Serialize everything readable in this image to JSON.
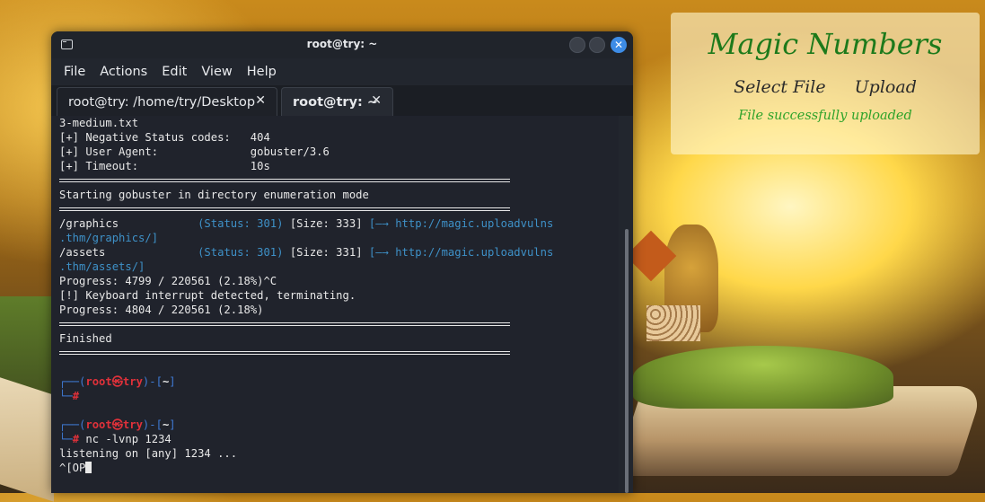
{
  "window": {
    "title": "root@try: ~",
    "close_glyph": "✕"
  },
  "menu": [
    "File",
    "Actions",
    "Edit",
    "View",
    "Help"
  ],
  "tabs": [
    {
      "label": "root@try: /home/try/Desktop",
      "close": "✕"
    },
    {
      "label": "root@try: ~",
      "close": "✕"
    }
  ],
  "terminal": {
    "lines": {
      "l1": "3-medium.txt",
      "l2": "[+] Negative Status codes:   404",
      "l3": "[+] User Agent:              gobuster/3.6",
      "l4": "[+] Timeout:                 10s",
      "l5": "Starting gobuster in directory enumeration mode",
      "r1_path": "/graphics            ",
      "r1_status": "(Status: 301)",
      "r1_size": " [Size: 333] ",
      "r1_link": "[—→ http://magic.uploadvulns",
      "r1_cont": ".thm/graphics/]",
      "r2_path": "/assets              ",
      "r2_status": "(Status: 301)",
      "r2_size": " [Size: 331] ",
      "r2_link": "[—→ http://magic.uploadvulns",
      "r2_cont": ".thm/assets/]",
      "p1": "Progress: 4799 / 220561 (2.18%)^C",
      "p2": "[!] Keyboard interrupt detected, terminating.",
      "p3": "Progress: 4804 / 220561 (2.18%)",
      "finished": "Finished"
    },
    "prompt": {
      "top_open": "┌──(",
      "user": "root㉿try",
      "top_mid": ")-[",
      "dir": "~",
      "top_close": "]",
      "bottom": "└─",
      "hash": "#"
    },
    "cmd": " nc -lvnp 1234",
    "listening": "listening on [any] 1234 ...",
    "input": "^[OP"
  },
  "webpage": {
    "title": "Magic Numbers",
    "select_file": "Select File",
    "upload": "Upload",
    "message": "File successfully uploaded"
  },
  "colors": {
    "terminal_bg": "#22262e",
    "link_blue": "#3e91c8",
    "prompt_red": "#e0313a",
    "frame_blue": "#3f7bd6",
    "accent_blue": "#3d8ce6",
    "web_title_green": "#1d7a1b",
    "web_msg_green": "#2fa32a"
  }
}
